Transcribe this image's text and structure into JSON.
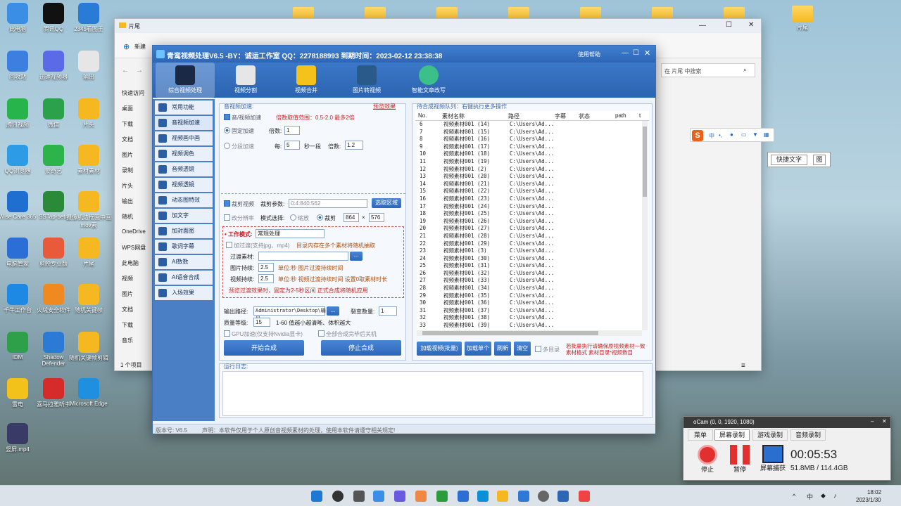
{
  "desktop": {
    "icons": [
      "此电脑",
      "腾讯QQ",
      "2345看图王",
      "回收站",
      "迅速视频器",
      "输出",
      "腾讯视频",
      "微信",
      "片头",
      "QQ浏览器",
      "爱奇艺",
      "素材素材",
      "Wise Care 365",
      "SSTap-beta",
      "摄像机边框画中画mov素",
      "电脑管家",
      "剪映专业版",
      "片尾",
      "千牛工作台",
      "火绒安全软件",
      "随机关键帧",
      "IDM",
      "Shadow Defender",
      "随机关键帧剪辑",
      "雷电",
      "喜马拉雅听书",
      "Microsoft Edge",
      "竖屏.mp4"
    ],
    "right_folder": "片尾",
    "top_folders": [
      "",
      "",
      "",
      "",
      "",
      "",
      ""
    ]
  },
  "explorer": {
    "title": "片尾",
    "new_label": "新建",
    "search_placeholder": "在 片尾 中搜索",
    "nav": [
      "快速访问",
      "桌面",
      "下载",
      "文档",
      "图片",
      "录制",
      "片头",
      "输出",
      "随机",
      "OneDrive",
      "WPS网盘",
      "此电脑",
      "视频",
      "图片",
      "文档",
      "下载",
      "音乐"
    ],
    "status": "1 个项目"
  },
  "ime": {
    "title": "S",
    "items": [
      "中",
      "•,",
      "🎤",
      "⌨",
      "👕",
      "▦"
    ],
    "quick_text": "快捷文字",
    "pic": "图"
  },
  "app": {
    "title": "青鸾视频处理V6.5  -BY：诚运工作室 QQ：2278188993   到期时间：2023-02-12 23:38:38",
    "help": "使用帮助",
    "toolbar": [
      "综合视频处理",
      "视频分割",
      "视频合并",
      "图片转视频",
      "智能文章改写"
    ],
    "sidebar": [
      "常用功能",
      "音视频加速",
      "视频画中画",
      "视频调色",
      "音频透镜",
      "视频透镜",
      "动态图特效",
      "加文字",
      "加封面图",
      "歌词字幕",
      "AI数数",
      "AI语音合成",
      "入场效果"
    ],
    "speed": {
      "group": "音视频加速:",
      "preset": "预览效果",
      "enable": "音/视频加速",
      "range": "倍数取值范围：0.5-2.0 最多2倍",
      "fixed": "固定加速",
      "mult_label": "倍数:",
      "mult_value": "1",
      "segment": "分段加速",
      "every": "每:",
      "every_value": "5",
      "per_seg": "秒一段",
      "mult2_label": "倍数:",
      "mult2_value": "1.2"
    },
    "crop": {
      "enable": "裁剪视频",
      "params_label": "裁剪参数:",
      "params_value": "0:4:840:562",
      "select_btn": "选取区域",
      "ratio": "改分辨率",
      "mode_label": "模式选择:",
      "scale": "缩放",
      "cut": "裁剪",
      "w": "864",
      "x": "×",
      "h": "576"
    },
    "work": {
      "label": "工作模式:",
      "value": "常规处理",
      "filter": "加过渡(支持jpg、mp4)",
      "filter_note": "目录内存在多个素材将随机抽取",
      "mat_label": "过渡素材:",
      "img_label": "图片持续:",
      "img_value": "2.5",
      "img_note": "单位:秒  图片过渡持续时间",
      "vid_label": "视频持续:",
      "vid_value": "2.5",
      "vid_note": "单位:秒  视频过渡持续时间 设置0取素材时长",
      "warn": "预览过渡效果时，固定为2-5秒区间 正式合成将随机应用"
    },
    "output": {
      "path_label": "输出路径:",
      "path_value": "Administrator\\Desktop\\输出",
      "split_label": "裂变数量:",
      "split_value": "1",
      "quality_label": "质量等级:",
      "quality_value": "15",
      "quality_note": "1-60 值越小越清晰、体积越大",
      "gpu": "GPU加速(仅支持Nvidia显卡)",
      "shutdown": "全部合成完毕后关机",
      "start": "开始合成",
      "stop": "停止合成"
    },
    "queue": {
      "title": "待合成视频队列：右键执行更多操作",
      "cols": [
        "No.",
        "素材名称",
        "路径",
        "字幕",
        "状态",
        "path",
        "t"
      ],
      "rows": [
        [
          "6",
          "视频素材001 (14)",
          "C:\\Users\\Ad..."
        ],
        [
          "7",
          "视频素材001 (15)",
          "C:\\Users\\Ad..."
        ],
        [
          "8",
          "视频素材001 (16)",
          "C:\\Users\\Ad..."
        ],
        [
          "9",
          "视频素材001 (17)",
          "C:\\Users\\Ad..."
        ],
        [
          "10",
          "视频素材001 (18)",
          "C:\\Users\\Ad..."
        ],
        [
          "11",
          "视频素材001 (19)",
          "C:\\Users\\Ad..."
        ],
        [
          "12",
          "视频素材001 (2)",
          "C:\\Users\\Ad..."
        ],
        [
          "13",
          "视频素材001 (20)",
          "C:\\Users\\Ad..."
        ],
        [
          "14",
          "视频素材001 (21)",
          "C:\\Users\\Ad..."
        ],
        [
          "15",
          "视频素材001 (22)",
          "C:\\Users\\Ad..."
        ],
        [
          "16",
          "视频素材001 (23)",
          "C:\\Users\\Ad..."
        ],
        [
          "17",
          "视频素材001 (24)",
          "C:\\Users\\Ad..."
        ],
        [
          "18",
          "视频素材001 (25)",
          "C:\\Users\\Ad..."
        ],
        [
          "19",
          "视频素材001 (26)",
          "C:\\Users\\Ad..."
        ],
        [
          "20",
          "视频素材001 (27)",
          "C:\\Users\\Ad..."
        ],
        [
          "21",
          "视频素材001 (28)",
          "C:\\Users\\Ad..."
        ],
        [
          "22",
          "视频素材001 (29)",
          "C:\\Users\\Ad..."
        ],
        [
          "23",
          "视频素材001 (3)",
          "C:\\Users\\Ad..."
        ],
        [
          "24",
          "视频素材001 (30)",
          "C:\\Users\\Ad..."
        ],
        [
          "25",
          "视频素材001 (31)",
          "C:\\Users\\Ad..."
        ],
        [
          "26",
          "视频素材001 (32)",
          "C:\\Users\\Ad..."
        ],
        [
          "27",
          "视频素材001 (33)",
          "C:\\Users\\Ad..."
        ],
        [
          "28",
          "视频素材001 (34)",
          "C:\\Users\\Ad..."
        ],
        [
          "29",
          "视频素材001 (35)",
          "C:\\Users\\Ad..."
        ],
        [
          "30",
          "视频素材001 (36)",
          "C:\\Users\\Ad..."
        ],
        [
          "31",
          "视频素材001 (37)",
          "C:\\Users\\Ad..."
        ],
        [
          "32",
          "视频素材001 (38)",
          "C:\\Users\\Ad..."
        ],
        [
          "33",
          "视频素材001 (39)",
          "C:\\Users\\Ad..."
        ]
      ],
      "btns": [
        "加载视频(批量)",
        "加载单个",
        "刷新",
        "清空"
      ],
      "multi": "多目录",
      "note1": "若批量执行请确保原视频素材一致",
      "note2": "素材格式 素材目录*视频数目"
    },
    "log": {
      "label": "运行日志:"
    },
    "footer": {
      "version": "版本号: V6.5",
      "notice": "声明：本软件仅用于个人原创音视频素材的处理，使用本软件请遵守相关规定!"
    }
  },
  "ocam": {
    "title": "oCam (0, 0, 1920, 1080)",
    "tabs": [
      "菜单",
      "屏幕录制",
      "游戏录制",
      "音频录制"
    ],
    "stop": "停止",
    "pause": "暂停",
    "capture": "屏幕捕获",
    "time": "00:05:53",
    "size": "51.8MB / 114.4GB"
  },
  "taskbar": {
    "time": "18:02",
    "date": "2023/1/30"
  }
}
